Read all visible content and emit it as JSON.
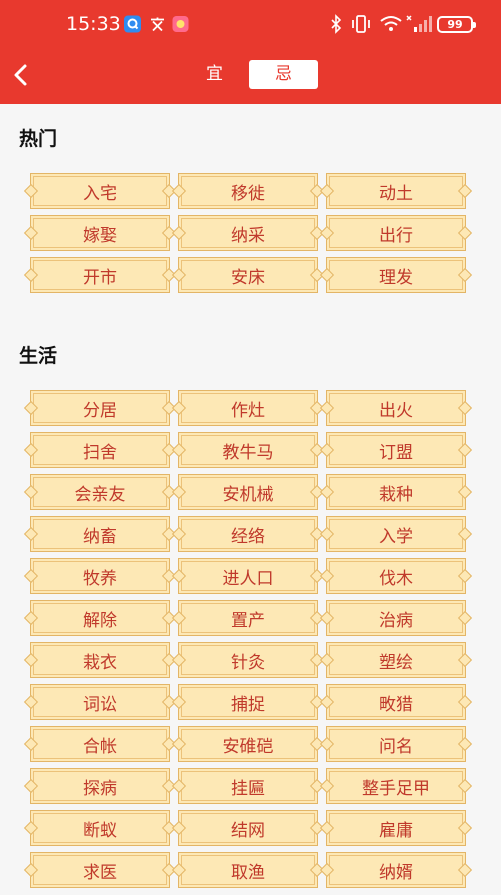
{
  "status_bar": {
    "time": "15:33",
    "battery": "99",
    "icons": [
      "chat-notification-icon",
      "translate-app-icon",
      "photo-app-icon",
      "bluetooth-icon",
      "vibrate-icon",
      "wifi-icon",
      "signal-icon"
    ]
  },
  "header": {
    "tabs": [
      {
        "label": "宜",
        "active": false
      },
      {
        "label": "忌",
        "active": true
      }
    ],
    "accent_color": "#e8392e"
  },
  "sections": [
    {
      "title": "热门",
      "items": [
        "入宅",
        "移徙",
        "动土",
        "嫁娶",
        "纳采",
        "出行",
        "开市",
        "安床",
        "理发"
      ]
    },
    {
      "title": "生活",
      "items": [
        "分居",
        "作灶",
        "出火",
        "扫舍",
        "教牛马",
        "订盟",
        "会亲友",
        "安机械",
        "栽种",
        "纳畜",
        "经络",
        "入学",
        "牧养",
        "进人口",
        "伐木",
        "解除",
        "置产",
        "治病",
        "栽衣",
        "针灸",
        "塑绘",
        "词讼",
        "捕捉",
        "畋猎",
        "合帐",
        "安碓硙",
        "问名",
        "探病",
        "挂匾",
        "整手足甲",
        "断蚁",
        "结网",
        "雇庸",
        "求医",
        "取渔",
        "纳婿"
      ]
    }
  ]
}
